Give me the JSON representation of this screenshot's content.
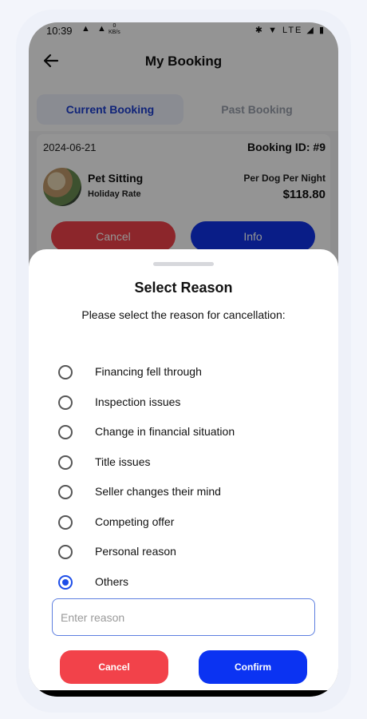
{
  "status_bar": {
    "time": "10:39",
    "left_icons": "▲ ▲",
    "net_speed": "0",
    "net_unit": "KB/s",
    "right_icons": "✱ ▼ LTE ◢ ▮"
  },
  "header": {
    "title": "My Booking",
    "back_icon": "arrow-left-icon"
  },
  "tabs": [
    {
      "label": "Current Booking",
      "active": true
    },
    {
      "label": "Past Booking",
      "active": false
    }
  ],
  "booking": {
    "date": "2024-06-21",
    "booking_id": "Booking ID: #9",
    "service": "Pet Sitting",
    "rate_type": "Holiday Rate",
    "price_unit": "Per Dog Per Night",
    "price": "$118.80",
    "cancel_label": "Cancel",
    "info_label": "Info"
  },
  "sheet": {
    "title": "Select Reason",
    "subtitle": "Please select the reason for cancellation:",
    "options": [
      {
        "label": "Financing fell through",
        "selected": false
      },
      {
        "label": "Inspection issues",
        "selected": false
      },
      {
        "label": "Change in financial situation",
        "selected": false
      },
      {
        "label": "Title issues",
        "selected": false
      },
      {
        "label": "Seller changes their mind",
        "selected": false
      },
      {
        "label": "Competing offer",
        "selected": false
      },
      {
        "label": "Personal reason",
        "selected": false
      },
      {
        "label": "Others",
        "selected": true
      }
    ],
    "reason_placeholder": "Enter reason",
    "reason_value": "",
    "cancel_label": "Cancel",
    "confirm_label": "Confirm"
  },
  "colors": {
    "accent_blue": "#0b33f2",
    "danger_red": "#f2424a",
    "tab_active_text": "#1d3ed0"
  }
}
